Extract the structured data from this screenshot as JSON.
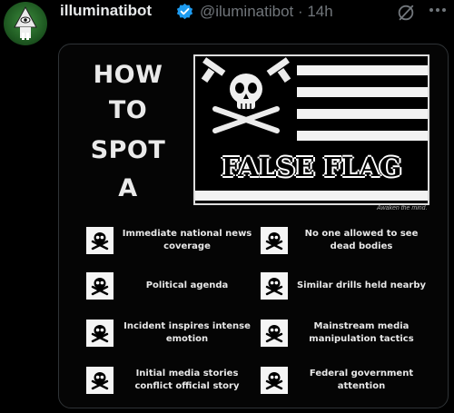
{
  "post": {
    "display_name": "illuminatibot",
    "handle_time": "@iluminatibot · 14h",
    "more_icon": "more-horizontal-icon",
    "colors": {
      "verified": "#1d9bf0",
      "muted": "#71767b",
      "text": "#e7e9ea"
    }
  },
  "meme": {
    "title_words": [
      "HOW",
      "TO",
      "SPOT",
      "A"
    ],
    "flag_text": "FALSE FLAG",
    "credit": "Awaken the mind.",
    "signs": [
      "Immediate national news coverage",
      "No one allowed to see dead bodies",
      "Political agenda",
      "Similar drills held nearby",
      "Incident inspires intense emotion",
      "Mainstream media manipulation tactics",
      "Initial media stories conflict official story",
      "Federal government attention"
    ]
  }
}
